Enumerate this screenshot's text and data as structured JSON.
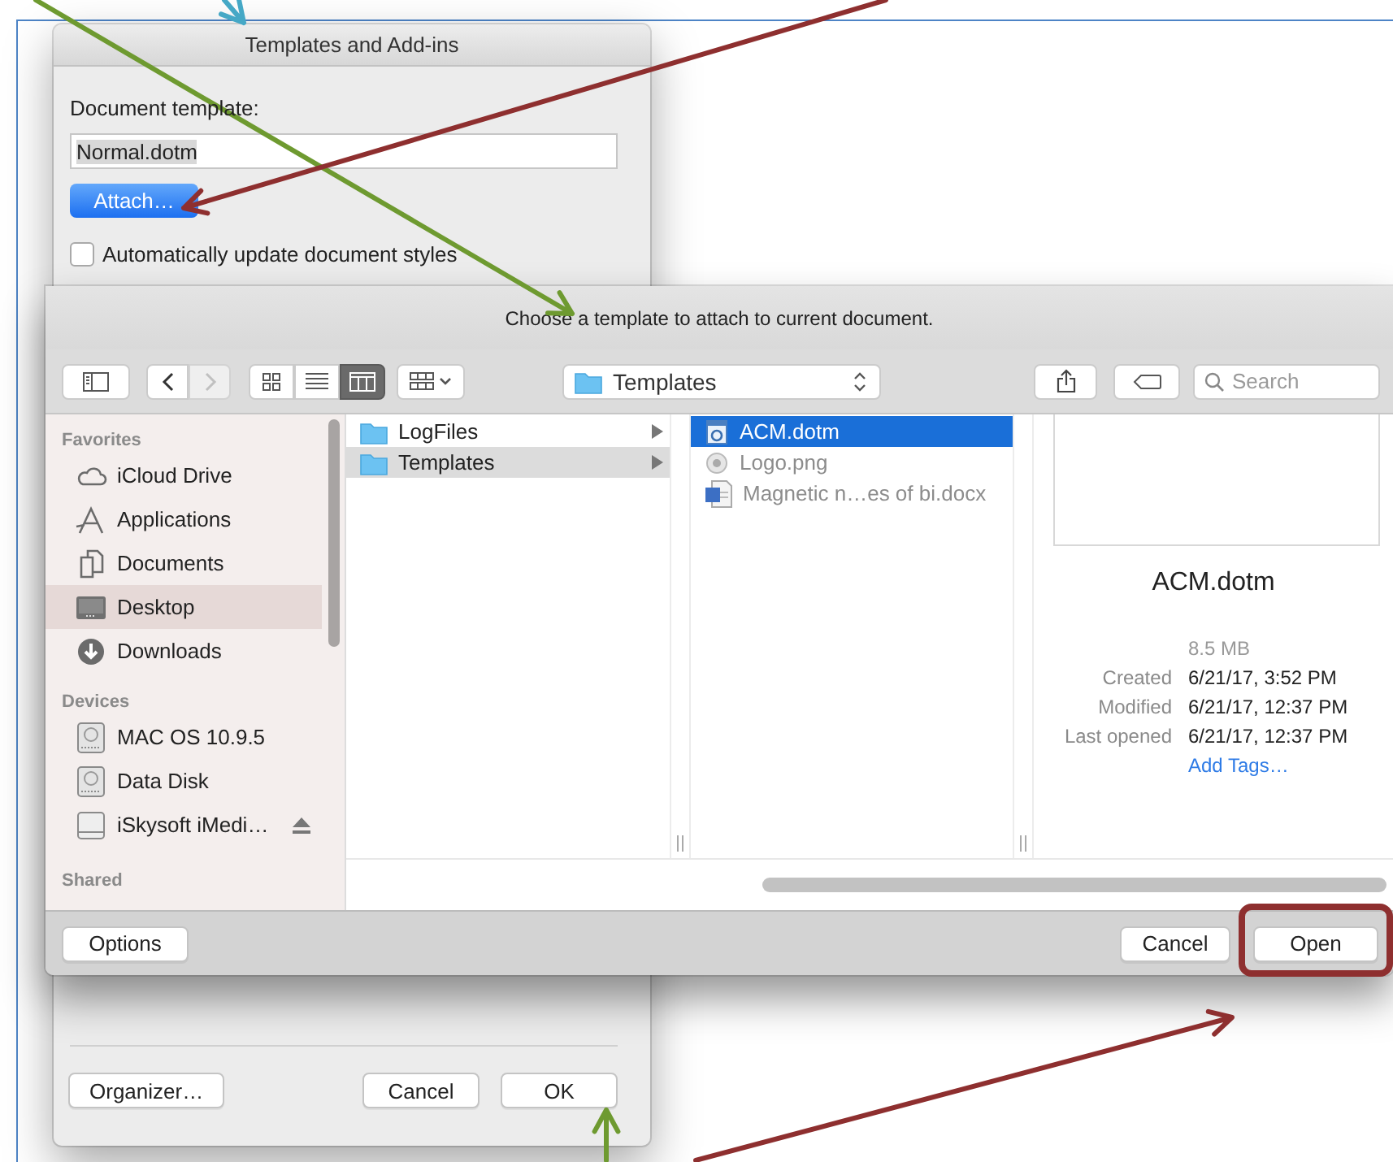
{
  "templates_dialog": {
    "title": "Templates and Add-ins",
    "template_label": "Document template:",
    "template_value": "Normal.dotm",
    "attach_button": "Attach…",
    "auto_update": {
      "label": "Automatically update document styles",
      "checked": false
    },
    "buttons": [
      "Organizer…",
      "Cancel",
      "OK"
    ]
  },
  "open_panel": {
    "message": "Choose a template to attach to current document.",
    "toolbar": {
      "nav": [
        {
          "kind": "back",
          "disabled": false
        },
        {
          "kind": "forward",
          "disabled": true
        }
      ],
      "view_modes": [
        {
          "kind": "icons",
          "selected": false
        },
        {
          "kind": "list",
          "selected": false
        },
        {
          "kind": "columns",
          "selected": true
        }
      ],
      "location": "Templates",
      "search": {
        "placeholder": "Search"
      }
    },
    "sidebar": [
      {
        "heading": "Favorites",
        "items": [
          {
            "label": "iCloud Drive",
            "kind": "cloud",
            "selected": false
          },
          {
            "label": "Applications",
            "kind": "applications",
            "selected": false
          },
          {
            "label": "Documents",
            "kind": "documents",
            "selected": false
          },
          {
            "label": "Desktop",
            "kind": "desktop",
            "selected": true
          },
          {
            "label": "Downloads",
            "kind": "downloads",
            "selected": false
          }
        ]
      },
      {
        "heading": "Devices",
        "items": [
          {
            "label": "MAC OS 10.9.5",
            "kind": "disk",
            "selected": false,
            "ejectable": false
          },
          {
            "label": "Data Disk",
            "kind": "disk",
            "selected": false,
            "ejectable": false
          },
          {
            "label": "iSkysoft iMedi…",
            "kind": "external",
            "selected": false,
            "ejectable": true
          }
        ]
      },
      {
        "heading": "Shared"
      }
    ],
    "columns": [
      {
        "active": false,
        "items": [
          {
            "label": "LogFiles",
            "kind": "folder",
            "selected": false,
            "disabled": false
          },
          {
            "label": "Templates",
            "kind": "folder",
            "selected": true,
            "disabled": false
          }
        ]
      },
      {
        "active": true,
        "items": [
          {
            "label": "ACM.dotm",
            "kind": "template",
            "selected": true,
            "disabled": false
          },
          {
            "label": "Logo.png",
            "kind": "image",
            "selected": false,
            "disabled": true
          },
          {
            "label": "Magnetic n…es of bi.docx",
            "kind": "word",
            "selected": false,
            "disabled": true
          }
        ]
      }
    ],
    "preview": {
      "name": "ACM.dotm",
      "size": "8.5 MB",
      "details": [
        {
          "label": "Created",
          "value": "6/21/17, 3:52 PM"
        },
        {
          "label": "Modified",
          "value": "6/21/17, 12:37 PM"
        },
        {
          "label": "Last opened",
          "value": "6/21/17, 12:37 PM"
        }
      ],
      "add_tags": "Add Tags…"
    },
    "buttons": [
      "Options",
      "Cancel",
      "Open"
    ]
  },
  "annotations": [
    {
      "kind": "arrow",
      "color": "#45a8c6"
    },
    {
      "kind": "arrow",
      "color": "#6e9a30"
    },
    {
      "kind": "arrow",
      "color": "#8e2f2f"
    },
    {
      "kind": "arrow",
      "color": "#6e9a30"
    },
    {
      "kind": "arrow",
      "color": "#8e2f2f"
    },
    {
      "kind": "highlight",
      "color": "#8e2f2f"
    }
  ]
}
